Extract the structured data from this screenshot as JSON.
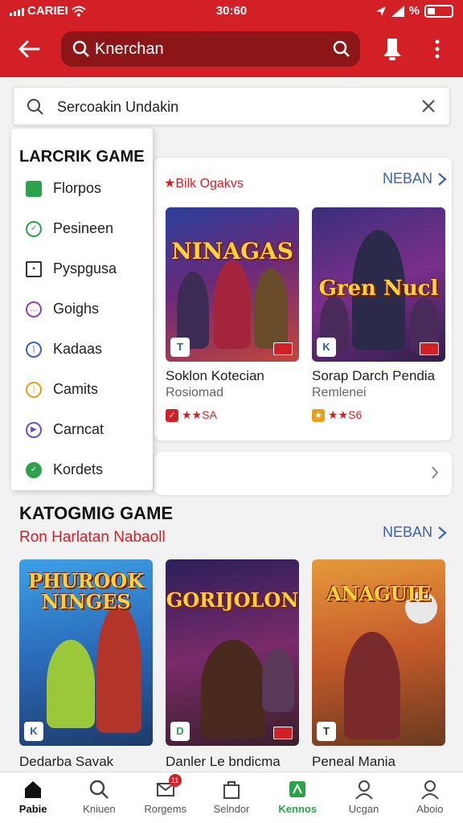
{
  "status_bar": {
    "carrier": "CARIEI",
    "time": "30:60",
    "battery": "%"
  },
  "header": {
    "search_text": "Knerchan"
  },
  "search": {
    "value": "Sercoakin Undakin"
  },
  "dropdown": {
    "title": "LARCRIK GAME",
    "items": [
      {
        "label": "Florpos",
        "icon": "grid-icon",
        "color": "#2ca24a"
      },
      {
        "label": "Pesineen",
        "icon": "check-circle-icon",
        "color": "#2ca24a"
      },
      {
        "label": "Pyspgusa",
        "icon": "grid-square-icon",
        "color": "#333333"
      },
      {
        "label": "Goighs",
        "icon": "chat-circle-icon",
        "color": "#8e44ad"
      },
      {
        "label": "Kadaas",
        "icon": "clock-icon",
        "color": "#3a63b5"
      },
      {
        "label": "Camits",
        "icon": "clock-icon",
        "color": "#e6a019"
      },
      {
        "label": "Carncat",
        "icon": "play-circle-icon",
        "color": "#6c4fc2"
      },
      {
        "label": "Kordets",
        "icon": "check-filled-icon",
        "color": "#2ca24a"
      }
    ]
  },
  "popular": {
    "tag": "★Bilk Ogakvs",
    "see_all": "NEBAN",
    "games": [
      {
        "art": "NINAGAS",
        "title": "Soklon Kotecian",
        "subtitle": "Rosiomad",
        "rating": "★★SA"
      },
      {
        "art": "Gren Nucl",
        "title": "Sorap Darch Pendia",
        "subtitle": "Remlenei",
        "rating": "★★S6"
      }
    ]
  },
  "category": {
    "title": "KATOGMIG GAME",
    "subtitle": "Ron Harlatan Nabaoll",
    "see_all": "NEBAN",
    "games": [
      {
        "art": "PHUROOK NINGES",
        "title": "Dedarba Savak"
      },
      {
        "art": "GORIJOLON",
        "title": "Danler Le bndicma"
      },
      {
        "art": "ANAGUIE",
        "title": "Peneal Mania"
      }
    ]
  },
  "bottom_nav": [
    {
      "label": "Pabie",
      "icon": "home-icon"
    },
    {
      "label": "Kniuen",
      "icon": "search-icon"
    },
    {
      "label": "Rorgems",
      "icon": "mail-icon",
      "badge": "11"
    },
    {
      "label": "Selndor",
      "icon": "bag-icon"
    },
    {
      "label": "Kennos",
      "icon": "map-icon"
    },
    {
      "label": "Ucgan",
      "icon": "person-icon"
    },
    {
      "label": "Aboio",
      "icon": "person-outline-icon"
    }
  ],
  "colors": {
    "brand_red": "#d32027",
    "link_blue": "#3a63b5",
    "active_green": "#2ca24a"
  }
}
